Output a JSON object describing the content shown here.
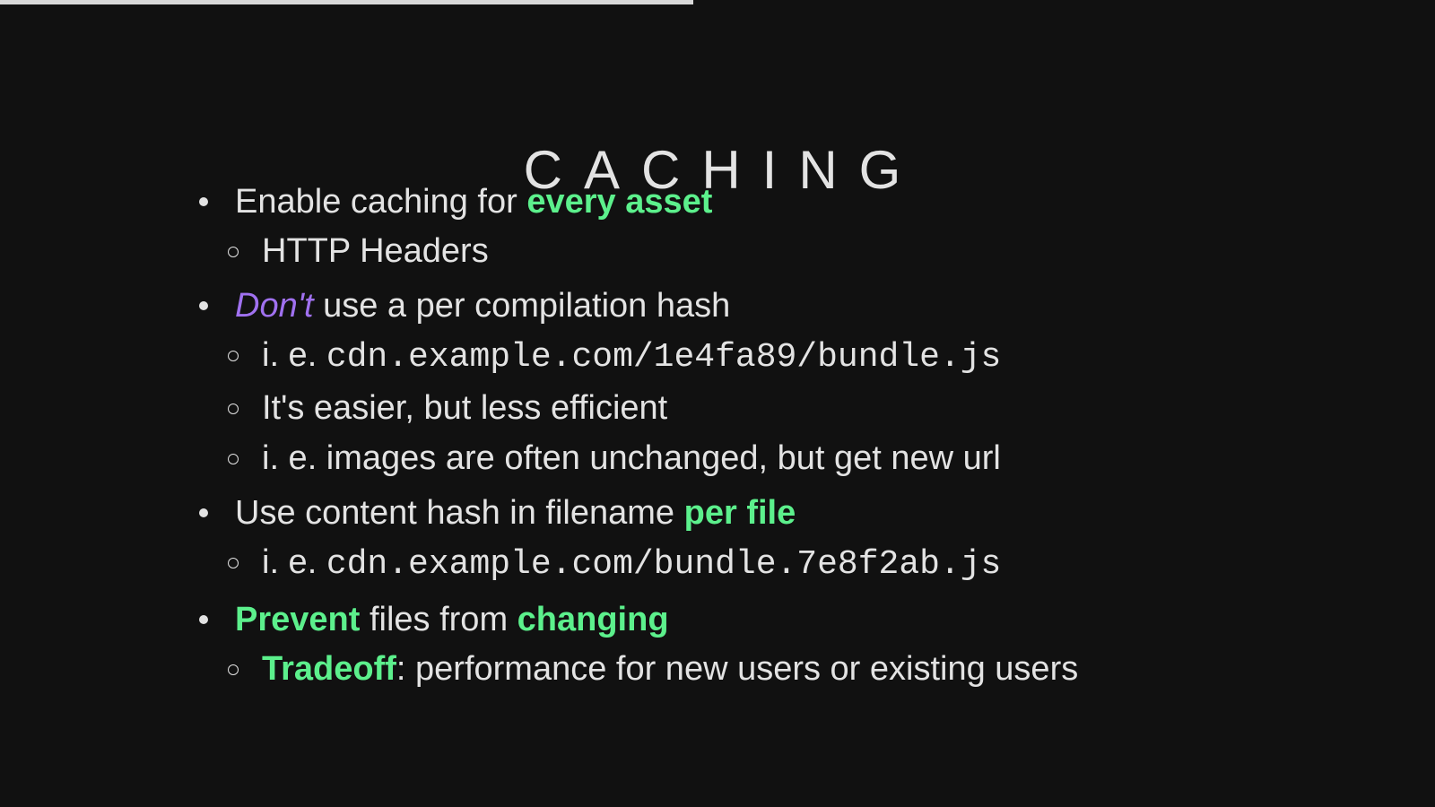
{
  "presentation": {
    "progress": 0.483
  },
  "slide": {
    "title": "CACHING",
    "bullets": [
      {
        "parts": [
          "Enable caching for ",
          "every asset"
        ],
        "sub": [
          {
            "text": "HTTP Headers"
          }
        ]
      },
      {
        "parts": [
          "Don't",
          " use a per compilation hash"
        ],
        "sub": [
          {
            "prefix": "i. e. ",
            "code": "cdn.example.com/1e4fa89/bundle.js"
          },
          {
            "text": "It's easier, but less efficient"
          },
          {
            "text": "i. e. images are often unchanged, but get new url"
          }
        ]
      },
      {
        "parts": [
          "Use content hash in filename ",
          "per file"
        ],
        "sub": [
          {
            "prefix": "i. e. ",
            "code": "cdn.example.com/bundle.7e8f2ab.js"
          }
        ]
      },
      {
        "parts": [
          "Prevent",
          " files from ",
          "changing"
        ],
        "sub": [
          {
            "parts": [
              "Tradeoff",
              ": performance for new users or existing users"
            ]
          }
        ]
      }
    ]
  },
  "colors": {
    "background": "#111111",
    "text": "#e3e3e3",
    "emphasis_green": "#5cf08c",
    "emphasis_purple": "#a071f0",
    "progress_bar": "#d9d9d9"
  }
}
